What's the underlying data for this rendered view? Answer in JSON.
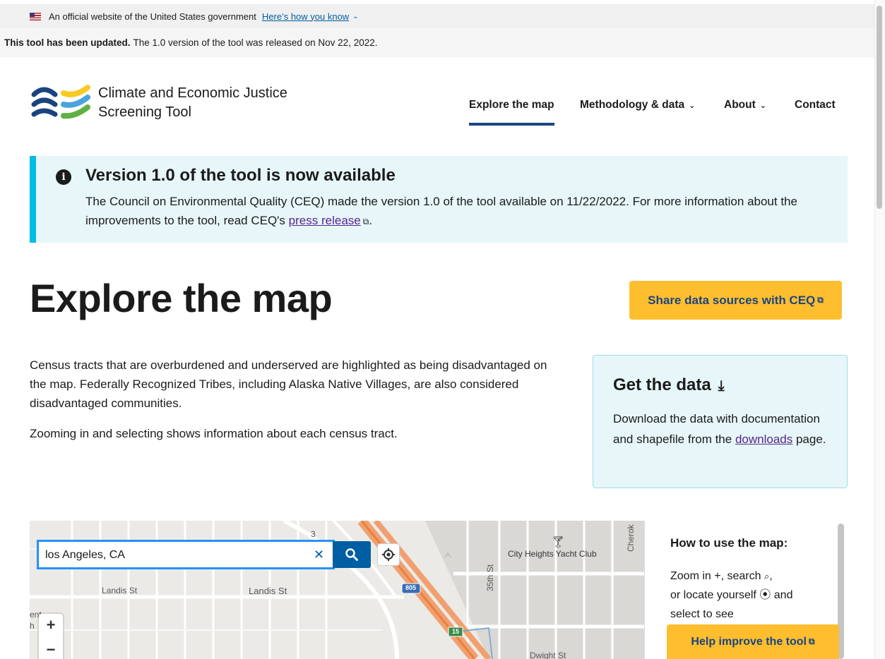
{
  "gov_banner": {
    "text": "An official website of the United States government",
    "link": "Here’s how you know"
  },
  "update_bar": {
    "bold": "This tool has been updated.",
    "text": "The 1.0 version of the tool was released on Nov 22, 2022."
  },
  "header": {
    "title_line1": "Climate and Economic Justice",
    "title_line2": "Screening Tool",
    "nav": [
      {
        "label": "Explore the map",
        "active": true
      },
      {
        "label": "Methodology & data",
        "dropdown": true
      },
      {
        "label": "About",
        "dropdown": true
      },
      {
        "label": "Contact"
      }
    ]
  },
  "alert": {
    "title": "Version 1.0 of the tool is now available",
    "body_before": "The Council on Environmental Quality (CEQ) made the version 1.0 of the tool available on 11/22/2022. For more information about the improvements to the tool, read CEQ's",
    "link": "press release",
    "body_after": "."
  },
  "main": {
    "title": "Explore the map",
    "share_button": "Share data sources with CEQ",
    "intro": "Census tracts that are overburdened and underserved are highlighted as being disadvantaged on the map. Federally Recognized Tribes, including Alaska Native Villages, are also considered disadvantaged communities.",
    "intro2": "Zooming in and selecting shows information about each census tract."
  },
  "get_data": {
    "title": "Get the data",
    "body_before": "Download the data with documentation and shapefile from the",
    "link": "downloads",
    "body_after": "page."
  },
  "map": {
    "search_value": "los Angeles, CA",
    "labels": {
      "landis1": "Landis St",
      "landis2": "Landis St",
      "yacht": "City Heights Yacht Club",
      "street35": "35th St",
      "cherok": "Cherok",
      "dwight": "Dwight St",
      "i805": "805",
      "r15": "15",
      "edge1": "ent",
      "edge2": "h",
      "num3": "3"
    }
  },
  "side_panel": {
    "title": "How to use the map:",
    "line1a": "Zoom in",
    "line1b": ", search",
    "line2a": "or locate yourself",
    "line2b": "and",
    "line3": "select to see",
    "help_button": "Help improve the tool"
  },
  "colors": {
    "primary": "#005ea2",
    "nav_underline": "#1a4480",
    "accent_yellow": "#ffbe2e",
    "alert_bg": "#e7f6f8",
    "alert_border": "#00bde3",
    "link_visited": "#54278f",
    "search_focus": "#2491ff"
  }
}
